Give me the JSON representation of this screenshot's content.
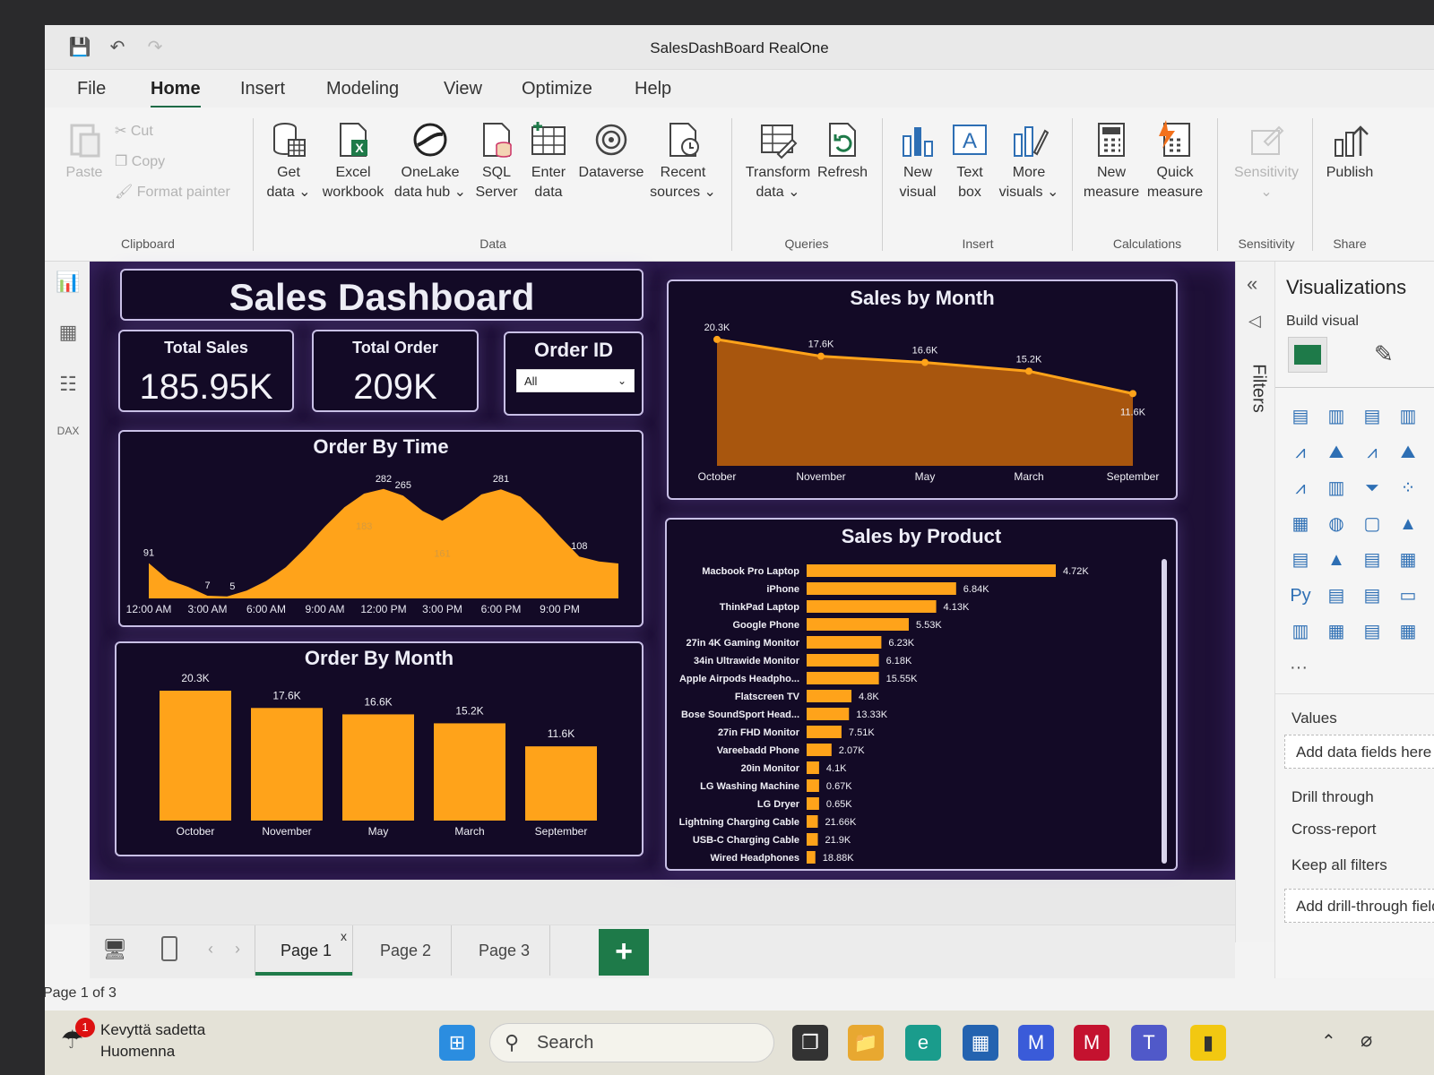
{
  "window": {
    "title": "SalesDashBoard RealOne"
  },
  "menu": {
    "tabs": [
      "File",
      "Home",
      "Insert",
      "Modeling",
      "View",
      "Optimize",
      "Help"
    ],
    "active": "Home"
  },
  "ribbon": {
    "clipboard": {
      "paste": "Paste",
      "cut": "Cut",
      "copy": "Copy",
      "format_painter": "Format painter",
      "group": "Clipboard"
    },
    "data": {
      "get_data": [
        "Get",
        "data ⌄"
      ],
      "excel": [
        "Excel",
        "workbook"
      ],
      "onelake": [
        "OneLake",
        "data hub ⌄"
      ],
      "sql": [
        "SQL",
        "Server"
      ],
      "enter": [
        "Enter",
        "data"
      ],
      "dataverse": "Dataverse",
      "recent": [
        "Recent",
        "sources ⌄"
      ],
      "group": "Data"
    },
    "queries": {
      "transform": [
        "Transform",
        "data ⌄"
      ],
      "refresh": "Refresh",
      "group": "Queries"
    },
    "insert": {
      "new_visual": [
        "New",
        "visual"
      ],
      "text_box": [
        "Text",
        "box"
      ],
      "more_visuals": [
        "More",
        "visuals ⌄"
      ],
      "group": "Insert"
    },
    "calculations": {
      "new_measure": [
        "New",
        "measure"
      ],
      "quick_measure": [
        "Quick",
        "measure"
      ],
      "group": "Calculations"
    },
    "sensitivity": {
      "label": "Sensitivity",
      "group": "Sensitivity"
    },
    "share": {
      "publish": "Publish",
      "group": "Share"
    }
  },
  "dashboard": {
    "title": "Sales Dashboard",
    "total_sales": {
      "label": "Total Sales",
      "value": "185.95K"
    },
    "total_order": {
      "label": "Total Order",
      "value": "209K"
    },
    "order_id": {
      "label": "Order ID",
      "selected": "All"
    },
    "order_by_time_title": "Order By Time",
    "sales_by_month_title": "Sales by Month",
    "order_by_month_title": "Order By Month",
    "sales_by_product_title": "Sales by Product"
  },
  "chart_data": [
    {
      "type": "area",
      "title": "Order By Time",
      "x_ticks": [
        "12:00 AM",
        "3:00 AM",
        "6:00 AM",
        "9:00 AM",
        "12:00 PM",
        "3:00 PM",
        "6:00 PM",
        "9:00 PM"
      ],
      "hours": [
        0,
        1,
        2,
        3,
        4,
        5,
        6,
        7,
        8,
        9,
        10,
        11,
        12,
        13,
        14,
        15,
        16,
        17,
        18,
        19,
        20,
        21,
        22,
        23,
        24
      ],
      "values": [
        91,
        48,
        30,
        7,
        5,
        20,
        45,
        80,
        130,
        185,
        235,
        270,
        282,
        265,
        225,
        200,
        230,
        268,
        281,
        262,
        215,
        160,
        108,
        95,
        90
      ],
      "data_labels": [
        "91",
        "7",
        "5",
        "282",
        "265",
        "183",
        "161",
        "281",
        "108"
      ]
    },
    {
      "type": "area",
      "title": "Sales by Month",
      "categories": [
        "October",
        "November",
        "May",
        "March",
        "September"
      ],
      "values": [
        20.3,
        17.6,
        16.6,
        15.2,
        11.6
      ],
      "data_labels": [
        "20.3K",
        "17.6K",
        "16.6K",
        "15.2K",
        "11.6K"
      ],
      "ylim": [
        0,
        21
      ]
    },
    {
      "type": "bar",
      "title": "Order By Month",
      "categories": [
        "October",
        "November",
        "May",
        "March",
        "September"
      ],
      "values": [
        20.3,
        17.6,
        16.6,
        15.2,
        11.6
      ],
      "data_labels": [
        "20.3K",
        "17.6K",
        "16.6K",
        "15.2K",
        "11.6K"
      ],
      "ylim": [
        0,
        21
      ]
    },
    {
      "type": "bar",
      "title": "Sales by Product",
      "categories": [
        "Macbook Pro Laptop",
        "iPhone",
        "ThinkPad Laptop",
        "Google Phone",
        "27in 4K Gaming Monitor",
        "34in Ultrawide Monitor",
        "Apple Airpods Headpho...",
        "Flatscreen TV",
        "Bose SoundSport Head...",
        "27in FHD Monitor",
        "Vareebadd Phone",
        "20in Monitor",
        "LG Washing Machine",
        "LG Dryer",
        "Lightning Charging Cable",
        "USB-C Charging Cable",
        "Wired Headphones"
      ],
      "bar_fraction": [
        1.0,
        0.6,
        0.52,
        0.41,
        0.3,
        0.29,
        0.29,
        0.18,
        0.17,
        0.14,
        0.1,
        0.05,
        0.05,
        0.05,
        0.045,
        0.045,
        0.035
      ],
      "data_labels": [
        "4.72K",
        "6.84K",
        "4.13K",
        "5.53K",
        "6.23K",
        "6.18K",
        "15.55K",
        "4.8K",
        "13.33K",
        "7.51K",
        "2.07K",
        "4.1K",
        "0.67K",
        "0.65K",
        "21.66K",
        "21.9K",
        "18.88K"
      ]
    }
  ],
  "filters": {
    "label": "Filters"
  },
  "visualizations": {
    "title": "Visualizations",
    "build_visual": "Build visual",
    "values_label": "Values",
    "values_placeholder": "Add data fields here",
    "drill_through": "Drill through",
    "cross_report": "Cross-report",
    "keep_filters": "Keep all filters",
    "drill_placeholder": "Add drill-through fields",
    "more": "···"
  },
  "pages": {
    "tabs": [
      "Page 1",
      "Page 2",
      "Page 3"
    ],
    "active": "Page 1",
    "add": "+",
    "close": "x"
  },
  "status": {
    "text": "Page 1 of 3"
  },
  "taskbar": {
    "weather_title": "Kevyttä sadetta",
    "weather_sub": "Huomenna",
    "badge": "1",
    "search": "Search"
  },
  "colors": {
    "accent": "#1e7a49",
    "bar": "#ffa31a",
    "area_fill": "#a8560e",
    "canvas": "#1e1036"
  }
}
